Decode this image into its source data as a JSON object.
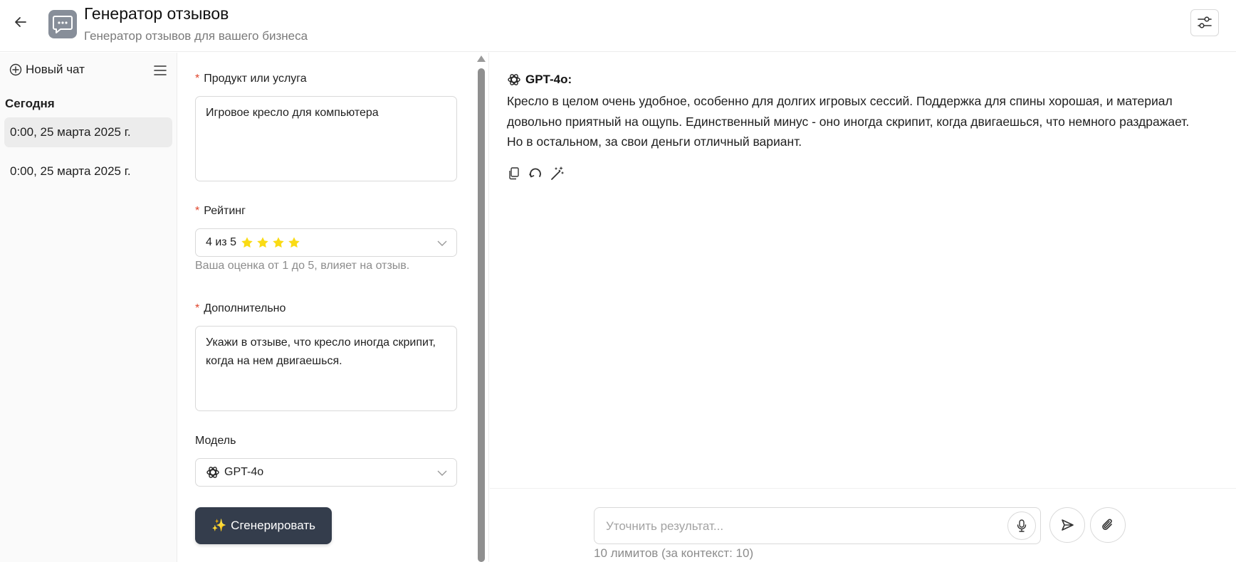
{
  "header": {
    "title": "Генератор отзывов",
    "subtitle": "Генератор отзывов для вашего бизнеса"
  },
  "sidebar": {
    "new_chat": "Новый чат",
    "section": "Сегодня",
    "items": [
      {
        "label": "0:00, 25 марта 2025 г.",
        "active": true
      },
      {
        "label": "0:00, 25 марта 2025 г.",
        "active": false
      }
    ]
  },
  "form": {
    "product": {
      "label": "Продукт или услуга",
      "value": "Игровое кресло для компьютера"
    },
    "rating": {
      "label": "Рейтинг",
      "value_text": "4 из 5",
      "stars": 4,
      "hint": "Ваша оценка от 1 до 5, влияет на отзыв."
    },
    "extra": {
      "label": "Дополнительно",
      "value": "Укажи в отзыве, что кресло иногда скрипит, когда на нем двигаешься."
    },
    "model": {
      "label": "Модель",
      "value": "GPT-4o"
    },
    "generate": {
      "icon": "✨",
      "label": "Сгенерировать"
    },
    "required_mark": "*"
  },
  "chat": {
    "message": {
      "author": "GPT-4o:",
      "text": "Кресло в целом очень удобное, особенно для долгих игровых сессий. Поддержка для спины хорошая, и материал довольно приятный на ощупь. Единственный минус - оно иногда скрипит, когда двигаешься, что немного раздражает. Но в остальном, за свои деньги отличный вариант."
    },
    "composer": {
      "placeholder": "Уточнить результат...",
      "limits": "10 лимитов (за контекст: 10)"
    }
  },
  "colors": {
    "accent_dark": "#343d4c",
    "star": "#fadb14",
    "required": "#e0452c",
    "active_item": "#ececec"
  }
}
